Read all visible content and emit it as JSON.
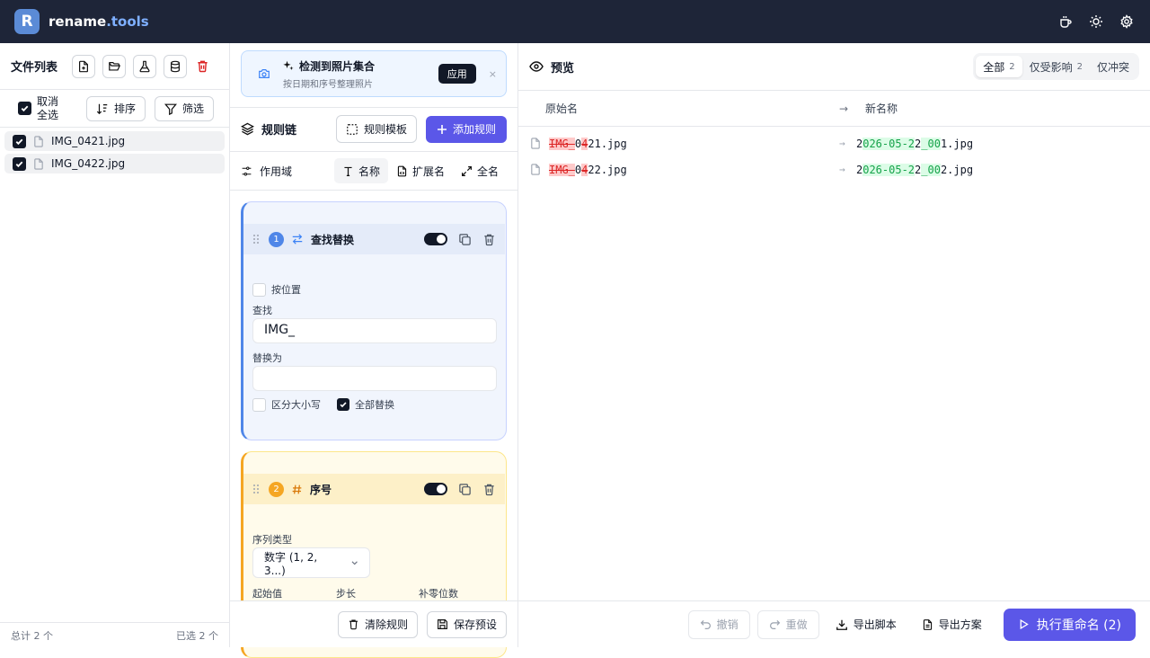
{
  "app": {
    "logo_letter": "R",
    "brand_name": "rename",
    "brand_tld": ".tools"
  },
  "left": {
    "title": "文件列表",
    "select_all_label": "取消全选",
    "sort_label": "排序",
    "filter_label": "筛选",
    "files": [
      {
        "name": "IMG_0421.jpg",
        "checked": true
      },
      {
        "name": "IMG_0422.jpg",
        "checked": true
      }
    ],
    "footer_total": "总计 2 个",
    "footer_selected": "已选 2 个"
  },
  "banner": {
    "title": "检测到照片集合",
    "subtitle": "按日期和序号整理照片",
    "apply_label": "应用",
    "close": "×"
  },
  "chain": {
    "title": "规则链",
    "template_label": "规则模板",
    "add_label": "添加规则"
  },
  "scope": {
    "label": "作用域",
    "tabs": [
      "名称",
      "扩展名",
      "全名"
    ],
    "active": "名称"
  },
  "rules": [
    {
      "index": "1",
      "name": "查找替换",
      "enabled": true,
      "by_position_label": "按位置",
      "find_label": "查找",
      "find_value": "IMG_",
      "replace_label": "替换为",
      "replace_value": "",
      "case_label": "区分大小写",
      "replace_all_label": "全部替换"
    },
    {
      "index": "2",
      "name": "序号",
      "enabled": true,
      "seq_type_label": "序列类型",
      "seq_type_value": "数字 (1, 2, 3...)",
      "start_label": "起始值",
      "step_label": "步长",
      "pad_label": "补零位数"
    }
  ],
  "mid_footer": {
    "clear_label": "清除规则",
    "save_label": "保存预设"
  },
  "preview": {
    "title": "预览",
    "segments": [
      {
        "label": "全部",
        "count": "2"
      },
      {
        "label": "仅受影响",
        "count": "2"
      },
      {
        "label": "仅冲突",
        "count": ""
      }
    ],
    "col_original": "原始名",
    "col_new": "新名称",
    "arrow": "→",
    "rows": [
      {
        "orig_del": "IMG_",
        "orig_a": "0",
        "orig_del2": "4",
        "orig_b": "21.jpg",
        "new_a": "2",
        "new_ins1": "026-05-2",
        "new_b": "2",
        "new_ins2": "_00",
        "new_c": "1.jpg"
      },
      {
        "orig_del": "IMG_",
        "orig_a": "0",
        "orig_del2": "4",
        "orig_b": "22.jpg",
        "new_a": "2",
        "new_ins1": "026-05-2",
        "new_b": "2",
        "new_ins2": "_00",
        "new_c": "2.jpg"
      }
    ]
  },
  "actions": {
    "undo": "撤销",
    "redo": "重做",
    "export_script": "导出脚本",
    "export_plan": "导出方案",
    "execute": "执行重命名 (2)"
  },
  "colors": {
    "topbar": "#1e2538",
    "accent": "#5b57e8",
    "rule1": "#4f86e8",
    "rule2": "#f5a623"
  }
}
